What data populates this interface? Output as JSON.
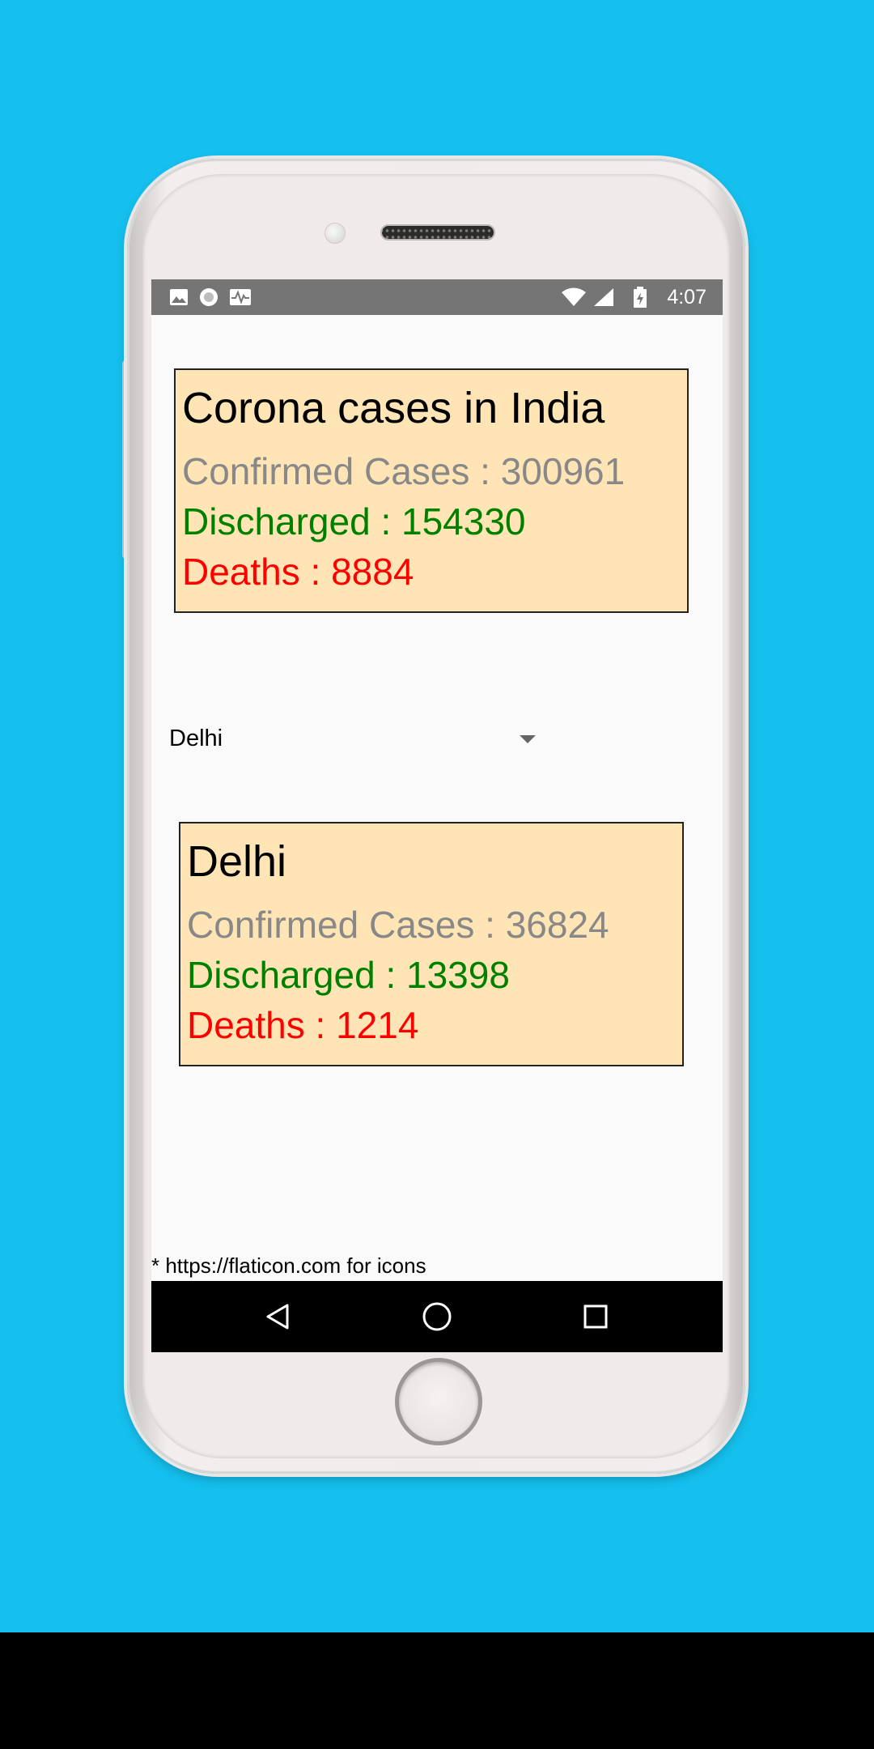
{
  "status_bar": {
    "time": "4:07",
    "left_icons": [
      "image-icon",
      "circle-notification-icon",
      "activity-icon"
    ],
    "right_icons": [
      "wifi-icon",
      "signal-icon",
      "battery-icon"
    ]
  },
  "india_card": {
    "title": "Corona cases in India",
    "confirmed": "Confirmed Cases : 300961",
    "discharged": "Discharged : 154330",
    "deaths": "Deaths : 8884"
  },
  "state_selector": {
    "selected": "Delhi"
  },
  "state_card": {
    "title": "Delhi",
    "confirmed": "Confirmed Cases : 36824",
    "discharged": "Discharged : 13398",
    "deaths": "Deaths : 1214"
  },
  "footer_note": "* https://flaticon.com for icons",
  "nav_bar": {
    "icons": [
      "back-icon",
      "home-icon",
      "recents-icon"
    ]
  },
  "colors": {
    "background": "#15bfee",
    "card_bg": "#ffe4b5",
    "confirmed": "#888888",
    "discharged": "#008000",
    "deaths": "#ff0000"
  }
}
